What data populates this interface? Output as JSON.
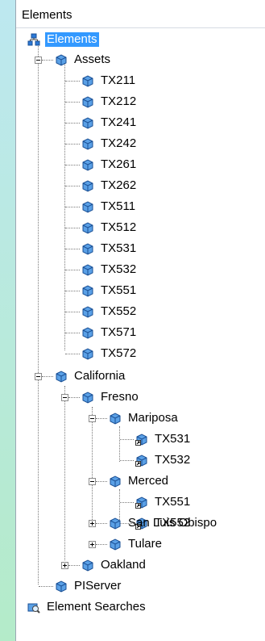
{
  "panel": {
    "title": "Elements"
  },
  "tree": {
    "root": "Elements",
    "assets": "Assets",
    "asset_items": [
      "TX211",
      "TX212",
      "TX241",
      "TX242",
      "TX261",
      "TX262",
      "TX511",
      "TX512",
      "TX531",
      "TX532",
      "TX551",
      "TX552",
      "TX571",
      "TX572"
    ],
    "california": "California",
    "fresno": "Fresno",
    "mariposa": "Mariposa",
    "mariposa_items": [
      "TX531",
      "TX532"
    ],
    "merced": "Merced",
    "merced_items": [
      "TX551",
      "TX552"
    ],
    "san_luis_obispo": "San Luis Obispo",
    "tulare": "Tulare",
    "oakland": "Oakland",
    "piserver": "PIServer",
    "element_searches": "Element Searches"
  },
  "colors": {
    "selection": "#3399ff",
    "icon_blue": "#2b78d6",
    "background_strip": "#a9e3d7"
  }
}
